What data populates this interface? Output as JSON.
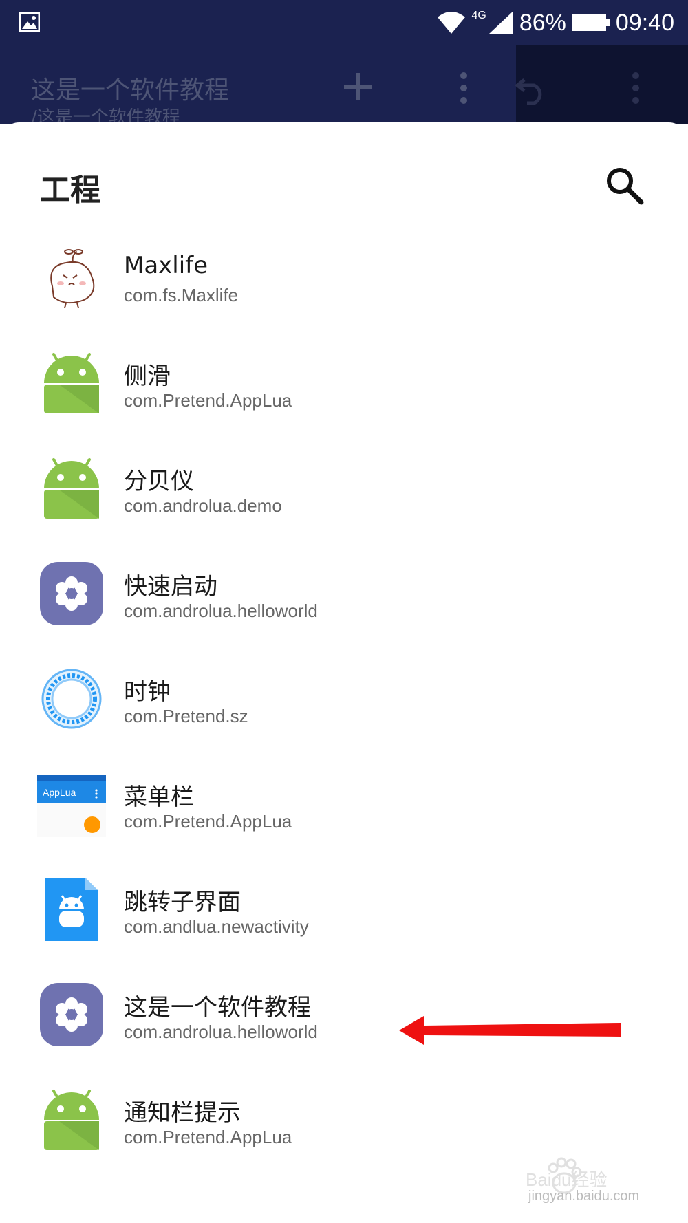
{
  "status_bar": {
    "network": "4G",
    "battery": "86%",
    "time": "09:40"
  },
  "toolbar": {
    "title": "这是一个软件教程",
    "subtitle": "/这是一个软件教程"
  },
  "sheet": {
    "title": "工程"
  },
  "projects": [
    {
      "name": "Maxlife",
      "package": "com.fs.Maxlife",
      "icon": "sprout-mascot-icon"
    },
    {
      "name": "侧滑",
      "package": "com.Pretend.AppLua",
      "icon": "android-icon"
    },
    {
      "name": "分贝仪",
      "package": "com.androlua.demo",
      "icon": "android-icon"
    },
    {
      "name": "快速启动",
      "package": "com.androlua.helloworld",
      "icon": "flower-icon"
    },
    {
      "name": "时钟",
      "package": "com.Pretend.sz",
      "icon": "clock-ring-icon"
    },
    {
      "name": "菜单栏",
      "package": "com.Pretend.AppLua",
      "icon": "applua-menu-icon",
      "icon_text": "AppLua"
    },
    {
      "name": "跳转子界面",
      "package": "com.andlua.newactivity",
      "icon": "android-file-icon"
    },
    {
      "name": "这是一个软件教程",
      "package": "com.androlua.helloworld",
      "icon": "flower-icon"
    },
    {
      "name": "通知栏提示",
      "package": "com.Pretend.AppLua",
      "icon": "android-icon"
    }
  ],
  "watermark": {
    "brand": "Baidu经验",
    "url": "jingyan.baidu.com"
  },
  "colors": {
    "appbar": "#1b2250",
    "android_green": "#8bc34a",
    "flower_purple": "#6f72b0",
    "arrow_red": "#ee1111"
  }
}
